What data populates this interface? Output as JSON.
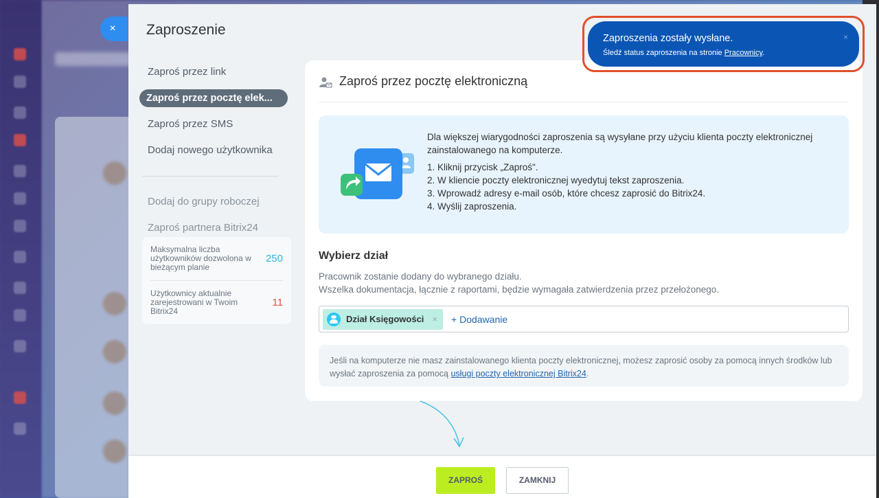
{
  "slider": {
    "title": "Zaproszenie",
    "close_label": "×"
  },
  "nav": {
    "items": [
      {
        "label": "Zaproś przez link"
      },
      {
        "label": "Zaproś przez pocztę elek..."
      },
      {
        "label": "Zaproś przez SMS"
      },
      {
        "label": "Dodaj nowego użytkownika"
      }
    ],
    "secondary": [
      {
        "label": "Dodaj do grupy roboczej"
      },
      {
        "label": "Zaproś partnera Bitrix24"
      }
    ]
  },
  "stats": [
    {
      "label": "Maksymalna liczba użytkowników dozwolona w bieżącym planie",
      "value": "250"
    },
    {
      "label": "Użytkownicy aktualnie zarejestrowani w Twoim Bitrix24",
      "value": "11"
    }
  ],
  "card": {
    "title": "Zaproś przez pocztę elektroniczną",
    "info_intro": "Dla większej wiarygodności zaproszenia są wysyłane przy użyciu klienta poczty elektronicznej zainstalowanego na komputerze.",
    "steps": [
      "1. Kliknij przycisk „Zaproś\".",
      "2. W kliencie poczty elektronicznej wyedytuj tekst zaproszenia.",
      "3. Wprowadź adresy e-mail osób, które chcesz zaprosić do Bitrix24.",
      "4. Wyślij zaproszenia."
    ],
    "dept_title": "Wybierz dział",
    "dept_desc_1": "Pracownik zostanie dodany do wybranego działu.",
    "dept_desc_2": "Wszelka dokumentacja, łącznie z raportami, będzie wymagała zatwierdzenia przez przełożonego.",
    "tag_label": "Dział Księgowości",
    "tag_remove": "×",
    "add_label": "+ Dodawanie",
    "note_text": "Jeśli na komputerze nie masz zainstalowanego klienta poczty elektronicznej, możesz zaprosić osoby za pomocą innych środków lub wysłać zaproszenia za pomocą ",
    "note_link": "usługi poczty elektronicznej Bitrix24",
    "note_end": "."
  },
  "footer": {
    "invite_label": "ZAPROŚ",
    "close_label": "ZAMKNIJ"
  },
  "toast": {
    "title": "Zaproszenia zostały wysłane.",
    "sub_text": "Śledź status zaproszenia na stronie ",
    "sub_link": "Pracownicy",
    "sub_end": ".",
    "close": "×"
  },
  "colors": {
    "accent": "#2fc6f6",
    "primary_button": "#bbed21",
    "toast": "#0b56b5",
    "highlight": "#e0502a"
  }
}
